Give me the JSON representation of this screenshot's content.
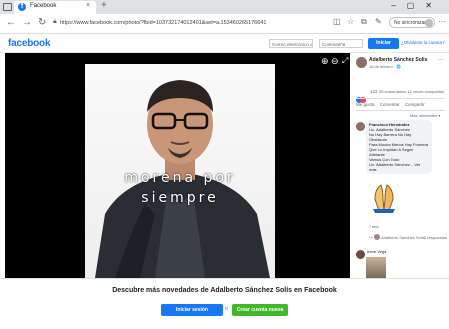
{
  "browser": {
    "tab_title": "Facebook",
    "tab_close": "×",
    "new_tab": "+",
    "window_controls": "–▢✕",
    "url": "https://www.facebook.com/photo/?fbid=103732174012401&set=a.153460265176641",
    "profile_label": "No sincronizado",
    "icons": [
      "back-icon",
      "forward-icon",
      "refresh-icon",
      "lock-icon",
      "tracking-icon",
      "favorite-icon",
      "collections-icon",
      "extensions-icon",
      "menu-icon"
    ]
  },
  "fb_header": {
    "logo": "facebook",
    "email_placeholder": "Correo electrónico o tel",
    "password_placeholder": "Contraseña",
    "login_label": "Iniciar sesión",
    "forgot_label": "¿Olvidaste la cuenta?"
  },
  "photo": {
    "caption_line1": "morena por",
    "caption_line2": "siempre",
    "zoom_in": "⊕",
    "zoom_out": "⊖",
    "expand": "⤢"
  },
  "post": {
    "author": "Adalberto Sánchez Solis",
    "date": "16 de febrero · 🌐",
    "more": "···",
    "reaction_count": "122",
    "stats": "35 comentarios  12 veces compartido",
    "actions": [
      "Me gusta",
      "Comentar",
      "Compartir"
    ],
    "sort_label": "Más relevantes ▾"
  },
  "comments": [
    {
      "author": "Francisco Hernández",
      "lines": [
        "Lic. Adalberto Sánchez",
        "No Hay Barrera No Hay Obstáculo",
        "Para Mucha Menos Hay Frontera",
        "Que Lo Impidan A Seguir Adelante",
        "Vamos Con Todo",
        "Lic. Adalberto Sánchez... Ver más"
      ],
      "time": "7 sem",
      "reply_prefix": "↪",
      "reply_name": "Adalberto Sánchez Solís",
      "reply_count": "2 respuestas"
    },
    {
      "author": "Irene Vega"
    }
  ],
  "banner": {
    "title": "Descubre más novedades de Adalberto Sánchez Solís en Facebook",
    "login_label": "Iniciar sesión",
    "or": "o",
    "create_label": "Crear cuenta nueva"
  },
  "colors": {
    "fb_blue": "#1877f2",
    "fb_green": "#42b72a",
    "viewer_bg": "#000000"
  }
}
